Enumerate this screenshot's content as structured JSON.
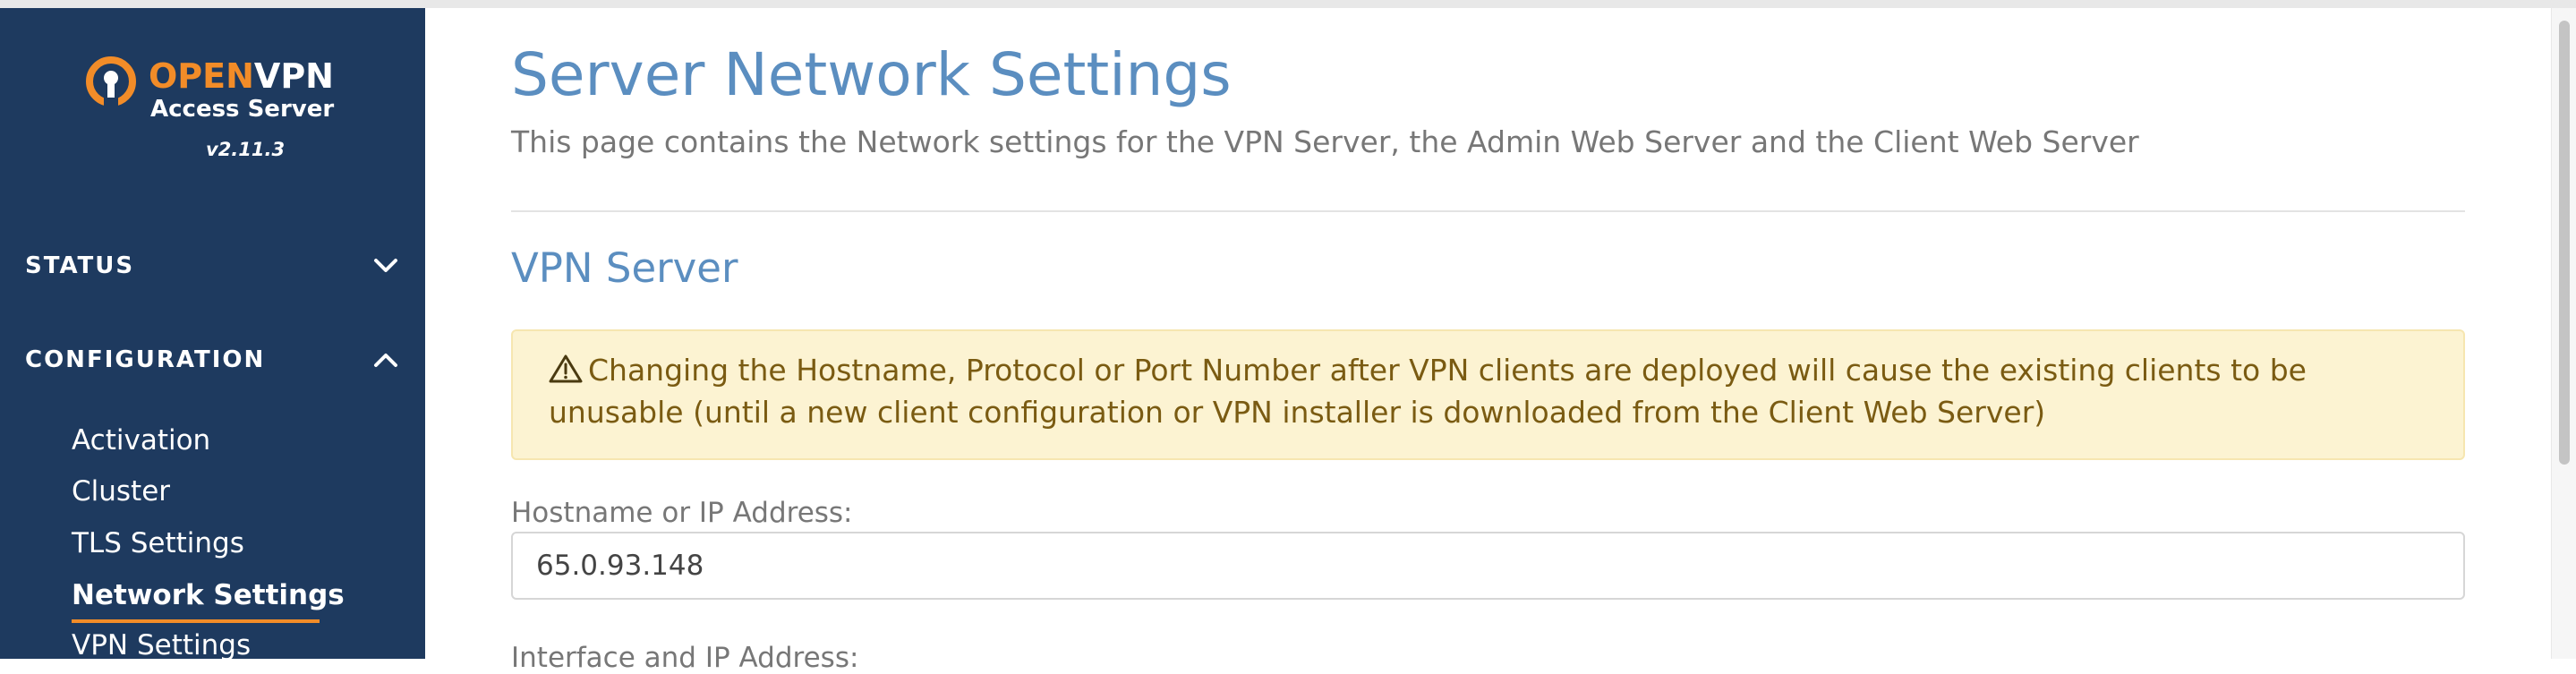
{
  "brand": {
    "word_open": "OPEN",
    "word_vpn": "VPN",
    "subtitle": "Access Server",
    "version": "v2.11.3",
    "colors": {
      "sidebar_bg": "#1e3a5f",
      "accent": "#f28c28",
      "heading": "#5b8ec0"
    }
  },
  "sidebar": {
    "sections": [
      {
        "label": "STATUS",
        "icon": "chevron-down-icon"
      },
      {
        "label": "CONFIGURATION",
        "icon": "chevron-up-icon"
      }
    ],
    "items": [
      {
        "label": "Activation"
      },
      {
        "label": "Cluster"
      },
      {
        "label": "TLS Settings"
      },
      {
        "label": "Network Settings",
        "active": true
      },
      {
        "label": "VPN Settings"
      }
    ]
  },
  "main": {
    "title": "Server Network Settings",
    "description": "This page contains the Network settings for the VPN Server, the Admin Web Server and the Client Web Server",
    "section_title": "VPN Server",
    "alert": {
      "icon": "warning-triangle-icon",
      "text": "Changing the Hostname, Protocol or Port Number after VPN clients are deployed will cause the existing clients to be unusable (until a new client configuration or VPN installer is downloaded from the Client Web Server)"
    },
    "hostname": {
      "label": "Hostname or IP Address:",
      "value": "65.0.93.148"
    },
    "next_label": "Interface and IP Address:"
  }
}
